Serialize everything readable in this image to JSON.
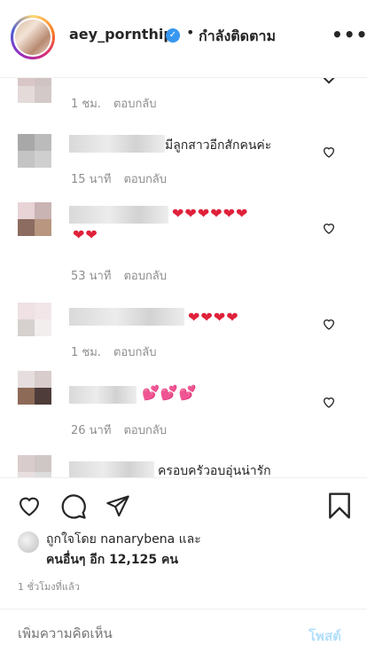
{
  "header": {
    "username": "aey_pornthip",
    "verified_icon": "✓",
    "separator": "•",
    "follow_status": "กำลังติดตาม",
    "more_icon": "•••"
  },
  "comments": [
    {
      "text": "",
      "time": "1 ชม.",
      "reply": "ตอบกลับ"
    },
    {
      "text": "มีลูกสาวอีกสักคนค่ะ",
      "time": "15 นาที",
      "reply": "ตอบกลับ"
    },
    {
      "hearts_line1": "❤❤❤❤❤❤",
      "hearts_line2": "❤❤",
      "time": "53 นาที",
      "reply": "ตอบกลับ"
    },
    {
      "hearts_line1": "❤❤❤❤",
      "time": "1 ชม.",
      "reply": "ตอบกลับ"
    },
    {
      "hearts_line1": "💕💕💕",
      "time": "26 นาที",
      "reply": "ตอบกลับ"
    },
    {
      "text": "ครอบครัวอบอุ่นน่ารัก"
    }
  ],
  "likes": {
    "line1": "ถูกใจโดย nanarybena และ",
    "line2": "คนอื่นๆ อีก 12,125 คน"
  },
  "posted_time": "1 ชั่วโมงที่แล้ว",
  "comment_box": {
    "placeholder": "เพิ่มความคิดเห็น",
    "post_label": "โพสต์"
  },
  "colors": {
    "heart": "#e0213a",
    "verified": "#3897f0",
    "post_disabled": "#b2dffc"
  }
}
